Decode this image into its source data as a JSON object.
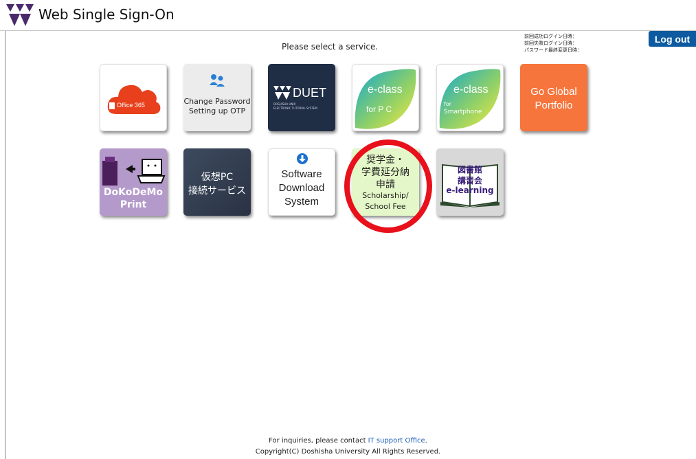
{
  "header": {
    "title": "Web Single Sign-On"
  },
  "main": {
    "instruction": "Please select a service."
  },
  "login_info": {
    "last_success": "前回成功ログイン日時：",
    "last_fail": "前回失敗ログイン日時：",
    "password_changed": "パスワード最終変更日時："
  },
  "logout_label": "Log out",
  "tiles": {
    "office365": {
      "label": "Office 365"
    },
    "password": {
      "line1": "Change Password",
      "line2": "Setting up OTP"
    },
    "duet": {
      "label": "DUET",
      "sub1": "DOSHISHA UNIX",
      "sub2": "ELECTRONIC TUTORIAL SYSTEM"
    },
    "eclass_pc": {
      "label": "e-class",
      "sub": "for P C"
    },
    "eclass_sp": {
      "label": "e-class",
      "sub1": "for",
      "sub2": "Smartphone"
    },
    "goglobal": {
      "line1": "Go Global",
      "line2": "Portfolio"
    },
    "dokodemo": {
      "line1": "DoKoDeMo",
      "line2": "Print"
    },
    "vpc": {
      "line1": "仮想PC",
      "line2": "接続サービス"
    },
    "software": {
      "line1": "Software",
      "line2": "Download",
      "line3": "System"
    },
    "scholarship": {
      "line1": "奨学金・",
      "line2": "学費延分納",
      "line3": "申請",
      "line4": "Scholarship/",
      "line5": "School Fee"
    },
    "library": {
      "line1": "図書館",
      "line2": "講習会",
      "line3": "e-learning"
    }
  },
  "footer": {
    "inquiry_prefix": "For inquiries, please contact ",
    "inquiry_link": "IT support Office",
    "inquiry_suffix": ".",
    "copyright": "Copyright(C) Doshisha University All Rights Reserved."
  },
  "colors": {
    "brand_purple": "#4b2a6b",
    "logout_blue": "#0d5aa0",
    "office_red": "#e8401c",
    "duet_navy": "#1f2d45",
    "goglobal_orange": "#f6753c",
    "dokodemo_purple": "#b49acb",
    "vpc_dark": "#2f3a4e",
    "scholarship_green": "#e4f7c8",
    "highlight_red": "#e8101a"
  }
}
